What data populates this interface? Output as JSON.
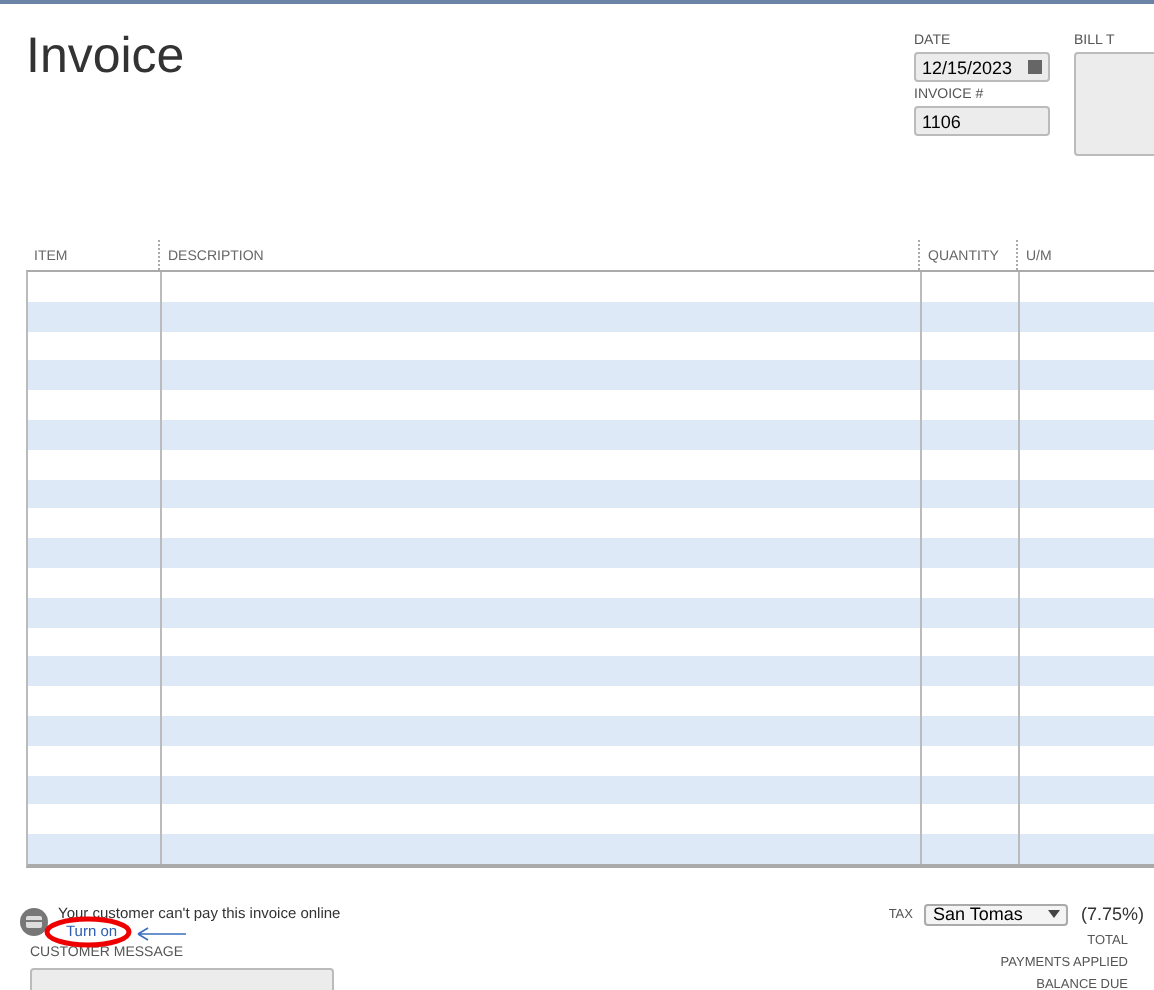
{
  "title": "Invoice",
  "date": {
    "label": "DATE",
    "value": "12/15/2023"
  },
  "invoice_number": {
    "label": "INVOICE #",
    "value": "1106"
  },
  "bill_to": {
    "label": "BILL T"
  },
  "table": {
    "columns": [
      "ITEM",
      "DESCRIPTION",
      "QUANTITY",
      "U/M"
    ],
    "rows": [
      {
        "shaded": false
      },
      {
        "shaded": true
      },
      {
        "shaded": false
      },
      {
        "shaded": true
      },
      {
        "shaded": false
      },
      {
        "shaded": true
      },
      {
        "shaded": false
      },
      {
        "shaded": true
      },
      {
        "shaded": false
      },
      {
        "shaded": true
      },
      {
        "shaded": false
      },
      {
        "shaded": true
      },
      {
        "shaded": false
      },
      {
        "shaded": true
      },
      {
        "shaded": false
      },
      {
        "shaded": true
      },
      {
        "shaded": false
      },
      {
        "shaded": true
      },
      {
        "shaded": false
      },
      {
        "shaded": true
      }
    ]
  },
  "online_payment": {
    "message": "Your customer can't pay this invoice online",
    "link": "Turn on"
  },
  "customer_message": {
    "label": "CUSTOMER MESSAGE"
  },
  "tax": {
    "label": "TAX",
    "value": "San Tomas",
    "rate": "(7.75%)"
  },
  "totals": [
    "TOTAL",
    "PAYMENTS APPLIED",
    "BALANCE DUE"
  ]
}
